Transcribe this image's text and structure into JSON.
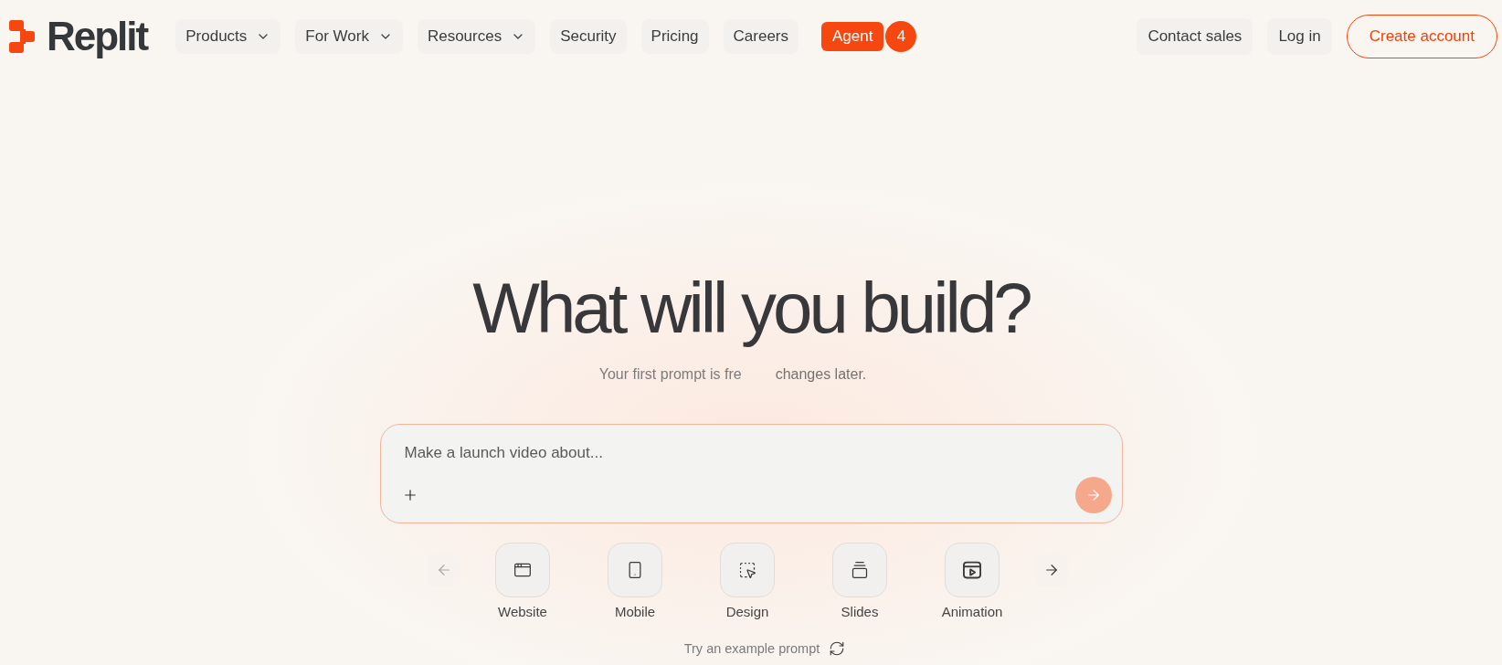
{
  "header": {
    "logo": {
      "text": "Replit"
    },
    "nav": [
      {
        "label": "Products",
        "dropdown": true
      },
      {
        "label": "For Work",
        "dropdown": true
      },
      {
        "label": "Resources",
        "dropdown": true
      },
      {
        "label": "Security",
        "dropdown": false
      },
      {
        "label": "Pricing",
        "dropdown": false
      },
      {
        "label": "Careers",
        "dropdown": false
      }
    ],
    "agent": {
      "label": "Agent",
      "badge": "4"
    },
    "actions": [
      {
        "label": "Contact sales",
        "kind": "plain"
      },
      {
        "label": "Log in",
        "kind": "plain"
      },
      {
        "label": "Create account",
        "kind": "outline"
      }
    ]
  },
  "hero": {
    "title": "What will you build?",
    "subtitle": [
      "Your first prompt is fre",
      "changes later."
    ]
  },
  "prompt": {
    "placeholder": "Make a launch video about...",
    "send": {
      "disabled": true
    }
  },
  "carousel": {
    "prev": {
      "disabled": true
    },
    "next": {
      "disabled": false
    },
    "categories": [
      {
        "label": "Website",
        "kind": "website"
      },
      {
        "label": "Mobile",
        "kind": "mobile"
      },
      {
        "label": "Design",
        "kind": "design"
      },
      {
        "label": "Slides",
        "kind": "slides"
      },
      {
        "label": "Animation",
        "kind": "animation"
      }
    ]
  },
  "example": {
    "label": "Try an example prompt"
  }
}
